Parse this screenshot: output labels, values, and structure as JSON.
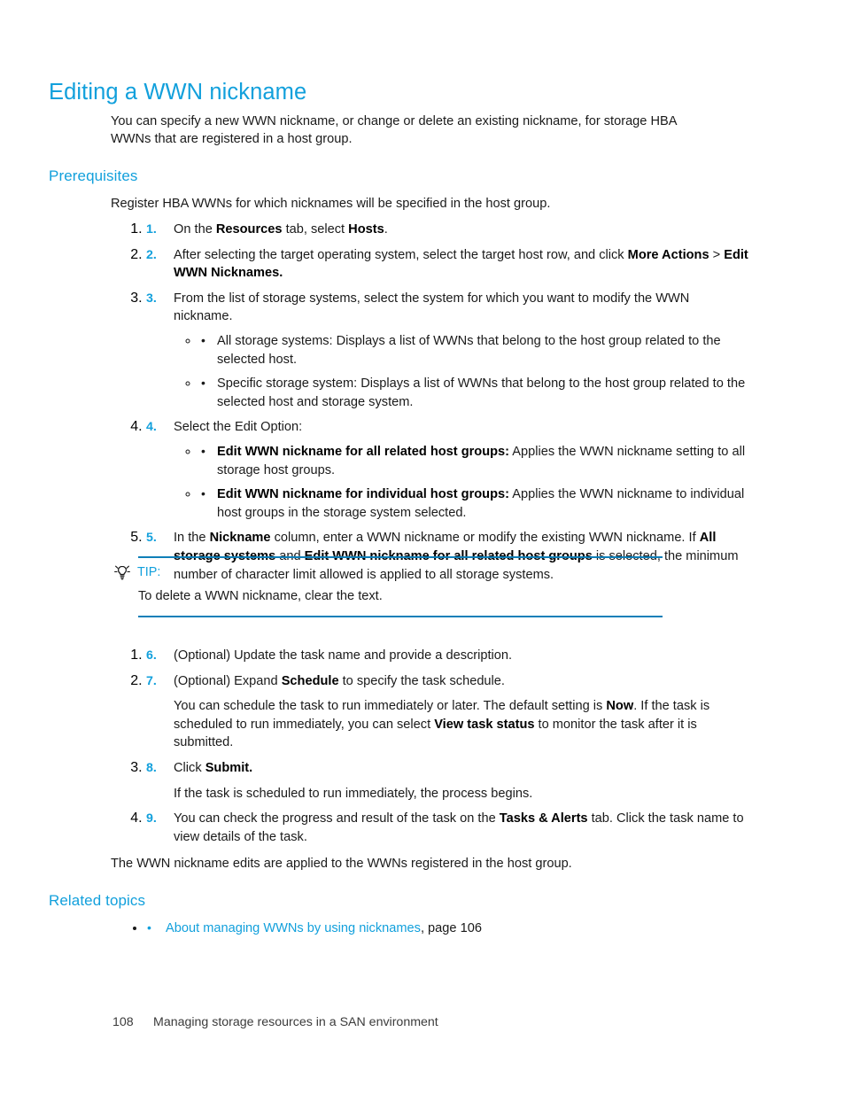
{
  "document": {
    "heading": "Editing a WWN nickname",
    "intro": "You can specify a new WWN nickname, or change or delete an existing nickname, for storage HBA WWNs that are registered in a host group."
  },
  "prerequisites": {
    "heading": "Prerequisites",
    "intro": "Register HBA WWNs for which nicknames will be specified in the host group."
  },
  "steps": [
    {
      "num": "1.",
      "parts": [
        {
          "text": "On the ",
          "bold": false
        },
        {
          "text": "Resources",
          "bold": true
        },
        {
          "text": " tab, select ",
          "bold": false
        },
        {
          "text": "Hosts",
          "bold": true
        },
        {
          "text": ".",
          "bold": false
        }
      ]
    },
    {
      "num": "2.",
      "parts": [
        {
          "text": "After selecting the target operating system, select the target host row, and click ",
          "bold": false
        },
        {
          "text": "More Actions",
          "bold": true
        },
        {
          "text": " > ",
          "bold": false
        },
        {
          "text": "Edit WWN Nicknames.",
          "bold": true
        }
      ]
    },
    {
      "num": "3.",
      "parts": [
        {
          "text": "From the list of storage systems, select the system for which you want to modify the WWN nickname.",
          "bold": false
        }
      ],
      "bullets": [
        {
          "parts": [
            {
              "text": "All storage systems: Displays a list of WWNs that belong to the host group related to the selected host.",
              "bold": false
            }
          ]
        },
        {
          "parts": [
            {
              "text": "Specific storage system: Displays a list of WWNs that belong to the host group related to the selected host and storage system.",
              "bold": false
            }
          ]
        }
      ]
    },
    {
      "num": "4.",
      "parts": [
        {
          "text": "Select the Edit Option:",
          "bold": false
        }
      ],
      "bullets": [
        {
          "parts": [
            {
              "text": "Edit WWN nickname for all related host groups:",
              "bold": true
            },
            {
              "text": " Applies the WWN nickname setting to all storage host groups.",
              "bold": false
            }
          ]
        },
        {
          "parts": [
            {
              "text": "Edit WWN nickname for individual host groups:",
              "bold": true
            },
            {
              "text": " Applies the WWN nickname to individual host groups in the storage system selected.",
              "bold": false
            }
          ]
        }
      ]
    },
    {
      "num": "5.",
      "parts": [
        {
          "text": "In the ",
          "bold": false
        },
        {
          "text": "Nickname",
          "bold": true
        },
        {
          "text": " column, enter a WWN nickname or modify the existing WWN nickname. If ",
          "bold": false
        },
        {
          "text": "All storage systems",
          "bold": true
        },
        {
          "text": " and ",
          "bold": false
        },
        {
          "text": "Edit WWN nickname for all related host groups",
          "bold": true
        },
        {
          "text": " is selected, the minimum number of character limit allowed is applied to all storage systems.",
          "bold": false
        }
      ]
    }
  ],
  "tip": {
    "icon": "lightbulb-icon",
    "label": "TIP:",
    "text": "To delete a WWN nickname, clear the text.",
    "rule_color": "#0f7fb8"
  },
  "steps_after_tip": [
    {
      "num": "6.",
      "parts": [
        {
          "text": "(Optional) Update the task name and provide a description.",
          "bold": false
        }
      ]
    },
    {
      "num": "7.",
      "parts": [
        {
          "text": "(Optional) Expand ",
          "bold": false
        },
        {
          "text": "Schedule",
          "bold": true
        },
        {
          "text": " to specify the task schedule.",
          "bold": false
        }
      ],
      "continuation": [
        {
          "text": "You can schedule the task to run immediately or later. The default setting is ",
          "bold": false
        },
        {
          "text": "Now",
          "bold": true
        },
        {
          "text": ". If the task is scheduled to run immediately, you can select ",
          "bold": false
        },
        {
          "text": "View task status",
          "bold": true
        },
        {
          "text": " to monitor the task after it is submitted.",
          "bold": false
        }
      ]
    },
    {
      "num": "8.",
      "parts": [
        {
          "text": "Click ",
          "bold": false
        },
        {
          "text": "Submit.",
          "bold": true
        }
      ],
      "continuation": [
        {
          "text": "If the task is scheduled to run immediately, the process begins.",
          "bold": false
        }
      ]
    },
    {
      "num": "9.",
      "parts": [
        {
          "text": "You can check the progress and result of the task on the ",
          "bold": false
        },
        {
          "text": "Tasks & Alerts",
          "bold": true
        },
        {
          "text": " tab. Click the task name to view details of the task.",
          "bold": false
        }
      ]
    }
  ],
  "closing": "The WWN nickname edits are applied to the WWNs registered in the host group.",
  "related_topics": {
    "heading": "Related topics",
    "items": [
      {
        "bullet": "•",
        "link_text": "About managing WWNs by using nicknames",
        "suffix": ", page 106"
      }
    ]
  },
  "footer": {
    "page_number": "108",
    "chapter_title": "Managing storage resources in a SAN environment"
  },
  "colors": {
    "heading_blue": "#12a0dc",
    "rule_blue": "#0f7fb8",
    "body_text": "#1a1a1a"
  }
}
